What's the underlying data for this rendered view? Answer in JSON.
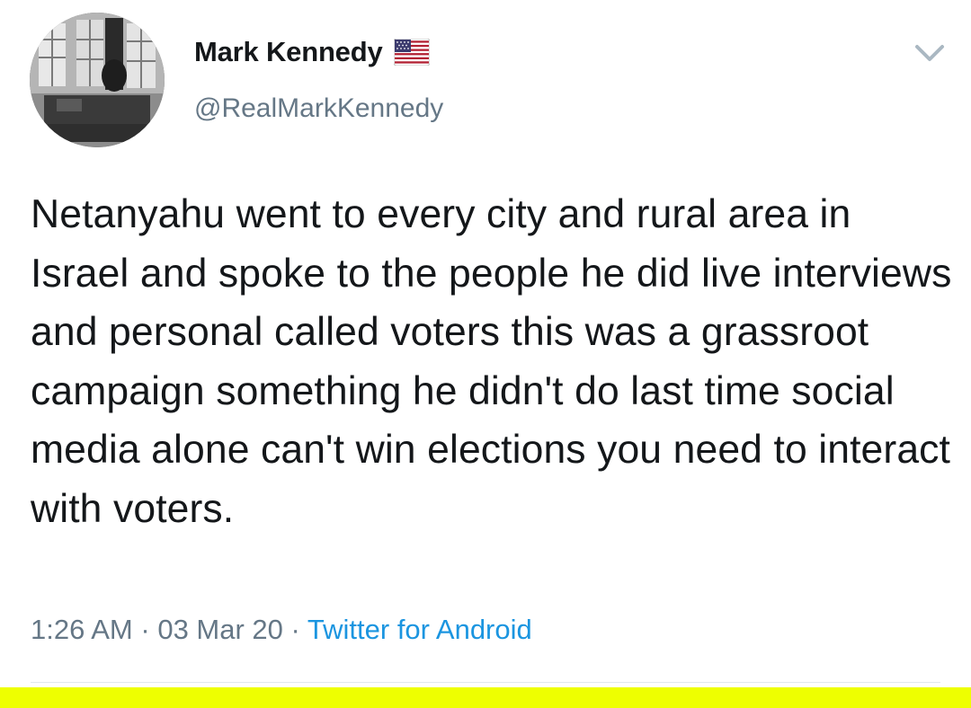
{
  "tweet": {
    "author": {
      "display_name": "Mark Kennedy",
      "handle": "@RealMarkKennedy",
      "flag_icon": "us-flag-icon"
    },
    "text": "Netanyahu went to every city and rural area in Israel and spoke to the people he did live interviews and personal called voters this was a grassroot campaign something he didn't do last time social media alone can't win elections you need to interact with voters.",
    "time": "1:26 AM",
    "separator": "·",
    "date": "03 Mar 20",
    "source": "Twitter for Android"
  },
  "colors": {
    "text": "#14171a",
    "secondary": "#657786",
    "link": "#1b95e0",
    "highlight": "#eeff00",
    "divider": "#e1e8ed"
  }
}
